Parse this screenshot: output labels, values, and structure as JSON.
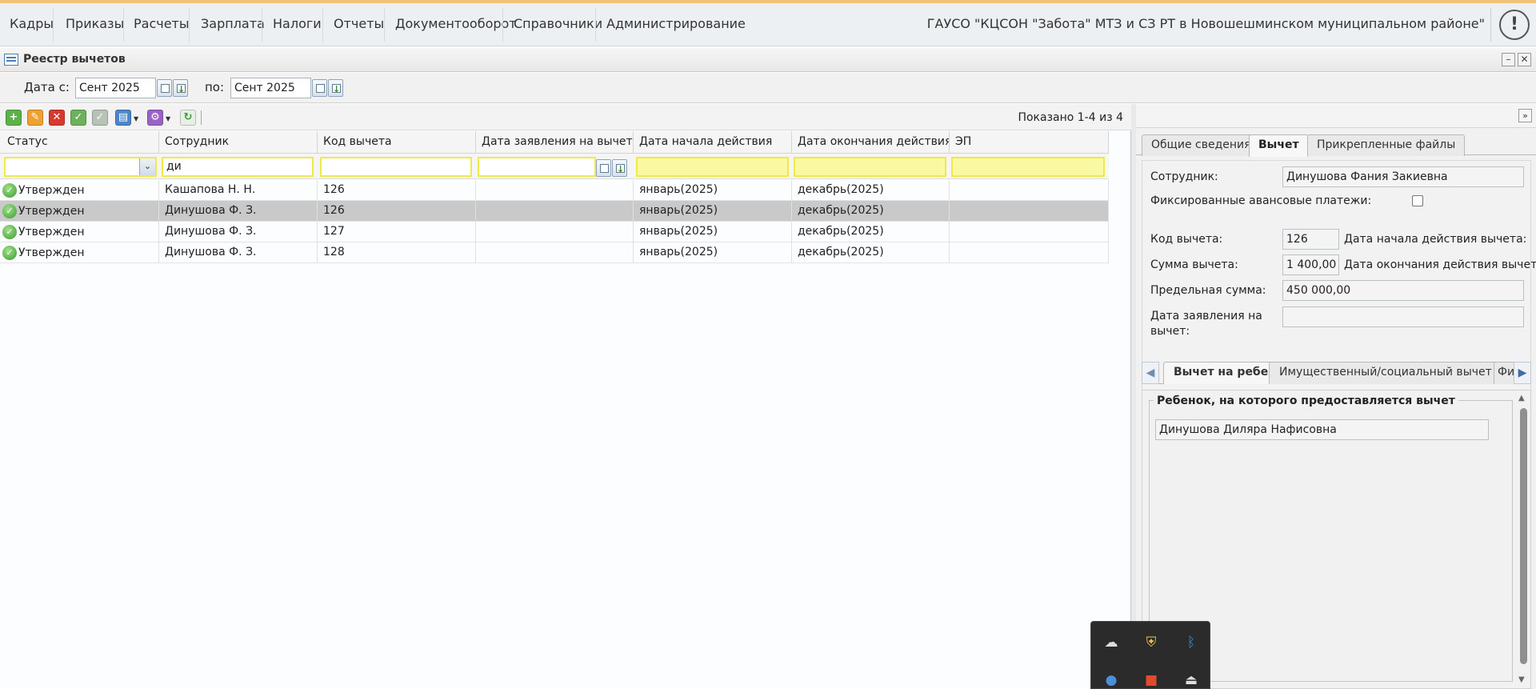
{
  "menu": {
    "items": [
      "Кадры",
      "Приказы",
      "Расчеты",
      "Зарплата",
      "Налоги",
      "Отчеты",
      "Документооборот",
      "Справочники",
      "Администрирование"
    ],
    "org_name": "ГАУСО \"КЦСОН \"Забота\" МТЗ и СЗ РТ в Новошешминском муниципальном районе\"",
    "alert_glyph": "!"
  },
  "window": {
    "title": "Реестр вычетов",
    "minimize_glyph": "–",
    "close_glyph": "✕",
    "pin_glyph": "✕"
  },
  "date_filter": {
    "from_label": "Дата с:",
    "from_value": "Сент 2025",
    "to_label": "по:",
    "to_value": "Сент 2025"
  },
  "toolbar": {
    "shown_text": "Показано 1-4 из 4",
    "icons": [
      "add-icon",
      "edit-icon",
      "delete-icon",
      "approve-icon",
      "unapprove-icon",
      "print-icon",
      "settings-icon",
      "refresh-icon"
    ]
  },
  "grid": {
    "columns": [
      "Статус",
      "Сотрудник",
      "Код вычета",
      "Дата заявления на вычет",
      "Дата начала действия",
      "Дата окончания действия",
      "ЭП"
    ],
    "filters": {
      "status": "",
      "employee": "ди",
      "code": "",
      "request_date": ""
    },
    "rows": [
      {
        "status": "Утвержден",
        "employee": "Кашапова Н. Н.",
        "code": "126",
        "request_date": "",
        "start": "январь(2025)",
        "end": "декабрь(2025)",
        "ep": ""
      },
      {
        "status": "Утвержден",
        "employee": "Динушова Ф. З.",
        "code": "126",
        "request_date": "",
        "start": "январь(2025)",
        "end": "декабрь(2025)",
        "ep": ""
      },
      {
        "status": "Утвержден",
        "employee": "Динушова Ф. З.",
        "code": "127",
        "request_date": "",
        "start": "январь(2025)",
        "end": "декабрь(2025)",
        "ep": ""
      },
      {
        "status": "Утвержден",
        "employee": "Динушова Ф. З.",
        "code": "128",
        "request_date": "",
        "start": "январь(2025)",
        "end": "декабрь(2025)",
        "ep": ""
      }
    ],
    "selected_row": 1
  },
  "details": {
    "collapse_glyph": "»",
    "tabs": [
      "Общие сведения",
      "Вычет",
      "Прикрепленные файлы"
    ],
    "active_tab": "Вычет",
    "fields": {
      "employee_label": "Сотрудник:",
      "employee_value": "Динушова Фания Закиевна",
      "fixed_payments_label": "Фиксированные авансовые платежи:",
      "code_label": "Код вычета:",
      "code_value": "126",
      "start_label": "Дата начала действия вычета:",
      "sum_label": "Сумма вычета:",
      "sum_value": "1 400,00",
      "end_label": "Дата окончания действия вычета",
      "limit_label": "Предельная сумма:",
      "limit_value": "450 000,00",
      "request_label_1": "Дата заявления на",
      "request_label_2": "вычет:",
      "request_value": ""
    },
    "subtabs": [
      "Вычет на ребенка",
      "Имущественный/социальный вычет",
      "Фи"
    ],
    "active_subtab": "Вычет на ребенка",
    "child_legend": "Ребенок, на которого предоставляется вычет",
    "child_name": "Динушова Диляра Нафисовна"
  },
  "colors": {
    "filter_border": "#f0e94a",
    "selected_row": "#c9c9c9",
    "status_green": "#3d9b2f"
  }
}
